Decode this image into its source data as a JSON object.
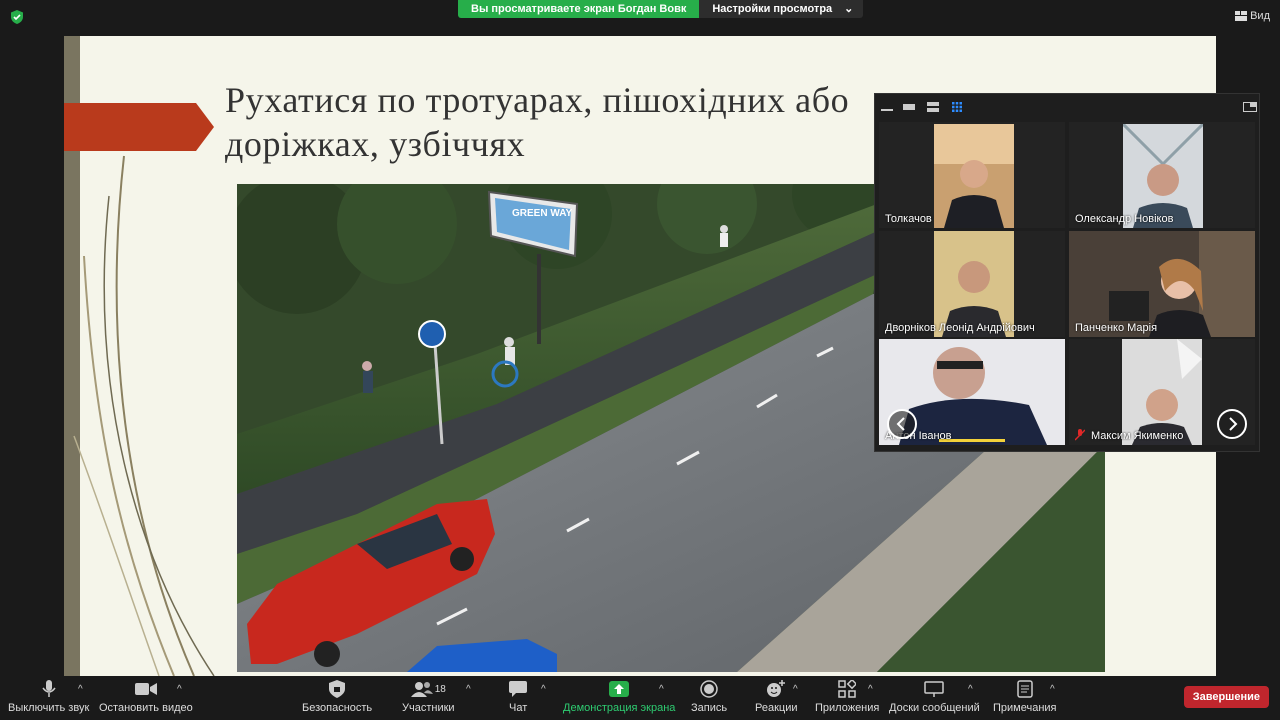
{
  "topbar": {
    "sharing_text": "Вы просматриваете экран Богдан Вовк",
    "view_options_label": "Настройки просмотра",
    "view_label": "Вид"
  },
  "slide": {
    "title_line1": "Рухатися по тротуарах, пішохідних або",
    "title_line2": "доріжках, узбіччях",
    "billboard_text": "GREEN WAY"
  },
  "gallery": {
    "participants": [
      {
        "name": "Толкачов"
      },
      {
        "name": "Олександр Новіков"
      },
      {
        "name": "Дворніков Леонід Андрійович"
      },
      {
        "name": "Панченко Марія"
      },
      {
        "name": "Антон Іванов"
      },
      {
        "name": "Максим Якименко",
        "muted": true
      }
    ]
  },
  "toolbar": {
    "mute_label": "Выключить звук",
    "video_label": "Остановить видео",
    "security_label": "Безопасность",
    "participants_label": "Участники",
    "participants_count": "18",
    "chat_label": "Чат",
    "share_label": "Демонстрация экрана",
    "record_label": "Запись",
    "reactions_label": "Реакции",
    "apps_label": "Приложения",
    "whiteboard_label": "Доски сообщений",
    "notes_label": "Примечания",
    "end_label": "Завершение"
  },
  "colors": {
    "accent_green": "#27ae4a",
    "end_red": "#c0262d",
    "slide_arrow": "#b93a1c",
    "background": "#1a1a1a"
  }
}
